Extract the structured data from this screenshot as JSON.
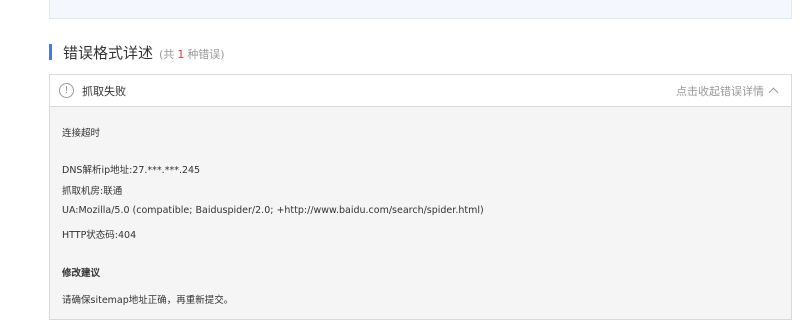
{
  "section": {
    "title": "错误格式详述",
    "count_prefix": "(共",
    "count_num": "1",
    "count_suffix": "种错误)"
  },
  "panel": {
    "header_title": "抓取失败",
    "toggle_label": "点击收起错误详情",
    "timeout": "连接超时",
    "dns": "DNS解析ip地址:27.***.***.245",
    "isp": "抓取机房:联通",
    "ua": "UA:Mozilla/5.0 (compatible; Baiduspider/2.0; +http://www.baidu.com/search/spider.html)",
    "status": "HTTP状态码:404",
    "advice_title": "修改建议",
    "advice_text": "请确保sitemap地址正确，再重新提交。"
  },
  "colors": {
    "accent": "#3b7cf0",
    "error_count": "#e4393c"
  }
}
